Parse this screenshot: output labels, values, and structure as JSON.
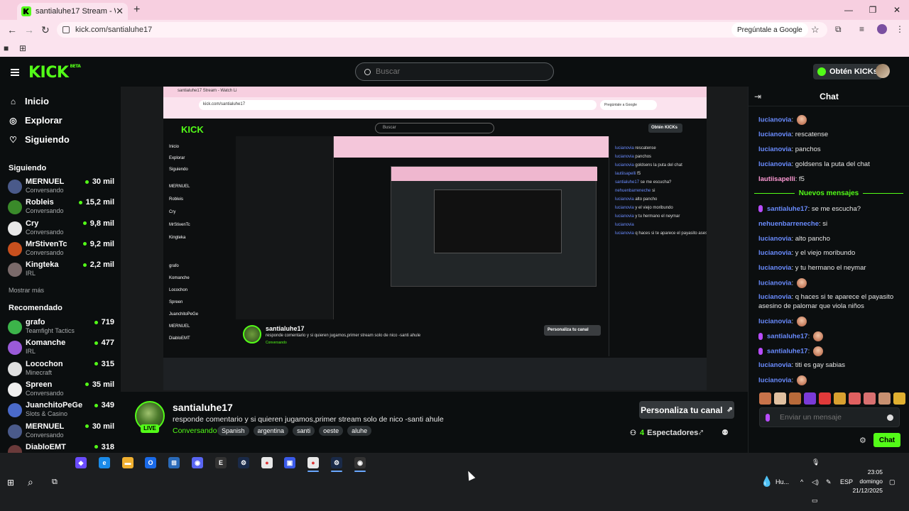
{
  "browser": {
    "tab_title": "santialuhe17 Stream - Watch Li",
    "url": "kick.com/santialuhe17",
    "ask_google": "Pregúntale a Google"
  },
  "header": {
    "logo": "KICK",
    "logo_sup": "BETA",
    "search_placeholder": "Buscar",
    "kicks_button": "Obtén KICKs"
  },
  "nav": [
    {
      "label": "Inicio",
      "icon": "home-icon"
    },
    {
      "label": "Explorar",
      "icon": "compass-icon"
    },
    {
      "label": "Siguiendo",
      "icon": "heart-icon"
    }
  ],
  "following": {
    "heading": "Siguiendo",
    "channels": [
      {
        "name": "MERNUEL",
        "category": "Conversando",
        "viewers": "30 mil",
        "color": "#4a5a8a"
      },
      {
        "name": "Robleis",
        "category": "Conversando",
        "viewers": "15,2 mil",
        "color": "#3a8a2a"
      },
      {
        "name": "Cry",
        "category": "Conversando",
        "viewers": "9,8 mil",
        "color": "#e8e8e8"
      },
      {
        "name": "MrStivenTc",
        "category": "Conversando",
        "viewers": "9,2 mil",
        "color": "#c8501e"
      },
      {
        "name": "Kingteka",
        "category": "IRL",
        "viewers": "2,2 mil",
        "color": "#7a6a6a"
      }
    ],
    "show_more": "Mostrar más"
  },
  "recommended": {
    "heading": "Recomendado",
    "channels": [
      {
        "name": "grafo",
        "category": "Teamfight Tactics",
        "viewers": "719",
        "color": "#3cb44a"
      },
      {
        "name": "Komanche",
        "category": "IRL",
        "viewers": "477",
        "color": "#9a5ad8"
      },
      {
        "name": "Locochon",
        "category": "Minecraft",
        "viewers": "315",
        "color": "#e0e0e0"
      },
      {
        "name": "Spreen",
        "category": "Conversando",
        "viewers": "35 mil",
        "color": "#f0f0f0"
      },
      {
        "name": "JuanchitoPeGe",
        "category": "Slots & Casino",
        "viewers": "349",
        "color": "#4a6aca"
      },
      {
        "name": "MERNUEL",
        "category": "Conversando",
        "viewers": "30 mil",
        "color": "#4a5a8a"
      },
      {
        "name": "DiabloEMT",
        "category": "",
        "viewers": "318",
        "color": "#6a3a3a"
      }
    ]
  },
  "stream": {
    "channel": "santialuhe17",
    "live": "LIVE",
    "title": "responde comentario y si quieren jugamos,primer stream solo de nico -santi ahule",
    "category": "Conversando",
    "tags": [
      "Spanish",
      "argentina",
      "santi",
      "oeste",
      "aluhe"
    ],
    "customize": "Personaliza tu canal",
    "viewers_count": "4",
    "viewers_label": "Espectadores"
  },
  "chat": {
    "title": "Chat",
    "new_messages": "Nuevos mensajes",
    "messages": [
      {
        "user": "lucianovia",
        "text": "",
        "emote": true,
        "color": "#6a8cff",
        "mic": false
      },
      {
        "user": "lucianovia",
        "text": "rescatense",
        "emote": false,
        "color": "#6a8cff",
        "mic": false
      },
      {
        "user": "lucianovia",
        "text": "panchos",
        "emote": false,
        "color": "#6a8cff",
        "mic": false
      },
      {
        "user": "lucianovia",
        "text": "goldsens la puta del chat",
        "emote": false,
        "color": "#6a8cff",
        "mic": false
      },
      {
        "user": "lautiisapelli",
        "text": "f5",
        "emote": false,
        "color": "#ff9ad5",
        "mic": false
      },
      {
        "user": "santialuhe17",
        "text": "se me escucha?",
        "emote": false,
        "color": "#6a8cff",
        "mic": true
      },
      {
        "user": "nehuenbarreneche",
        "text": "si",
        "emote": false,
        "color": "#6a8cff",
        "mic": false
      },
      {
        "user": "lucianovia",
        "text": "alto pancho",
        "emote": false,
        "color": "#6a8cff",
        "mic": false
      },
      {
        "user": "lucianovia",
        "text": "y el viejo moribundo",
        "emote": false,
        "color": "#6a8cff",
        "mic": false
      },
      {
        "user": "lucianovia",
        "text": "y tu hermano el neymar",
        "emote": false,
        "color": "#6a8cff",
        "mic": false
      },
      {
        "user": "lucianovia",
        "text": "",
        "emote": true,
        "color": "#6a8cff",
        "mic": false
      },
      {
        "user": "lucianovia",
        "text": "q haces si te aparece el payasito asesino de palomar que viola niños",
        "emote": false,
        "color": "#6a8cff",
        "mic": false
      },
      {
        "user": "lucianovia",
        "text": "",
        "emote": true,
        "color": "#6a8cff",
        "mic": false
      },
      {
        "user": "santialuhe17",
        "text": "",
        "emote": true,
        "color": "#6a8cff",
        "mic": true
      },
      {
        "user": "santialuhe17",
        "text": "",
        "emote": true,
        "color": "#6a8cff",
        "mic": true
      },
      {
        "user": "lucianovia",
        "text": "titi es gay sabias",
        "emote": false,
        "color": "#6a8cff",
        "mic": false
      },
      {
        "user": "lucianovia",
        "text": "",
        "emote": true,
        "color": "#6a8cff",
        "mic": false
      }
    ],
    "input_placeholder": "Enviar un mensaje",
    "send_button": "Chat"
  },
  "taskbar": {
    "apps": [
      "copilot-icon",
      "edge-icon",
      "folder-icon",
      "outlook-icon",
      "store-icon",
      "discord-icon",
      "epic-icon",
      "steam-icon",
      "chrome-icon",
      "app-icon",
      "chrome-active-icon",
      "steam-active-icon",
      "obs-icon"
    ],
    "weather": "Hu...",
    "lang": "ESP",
    "time": "23:05",
    "day": "domingo",
    "date": "21/12/2025"
  }
}
